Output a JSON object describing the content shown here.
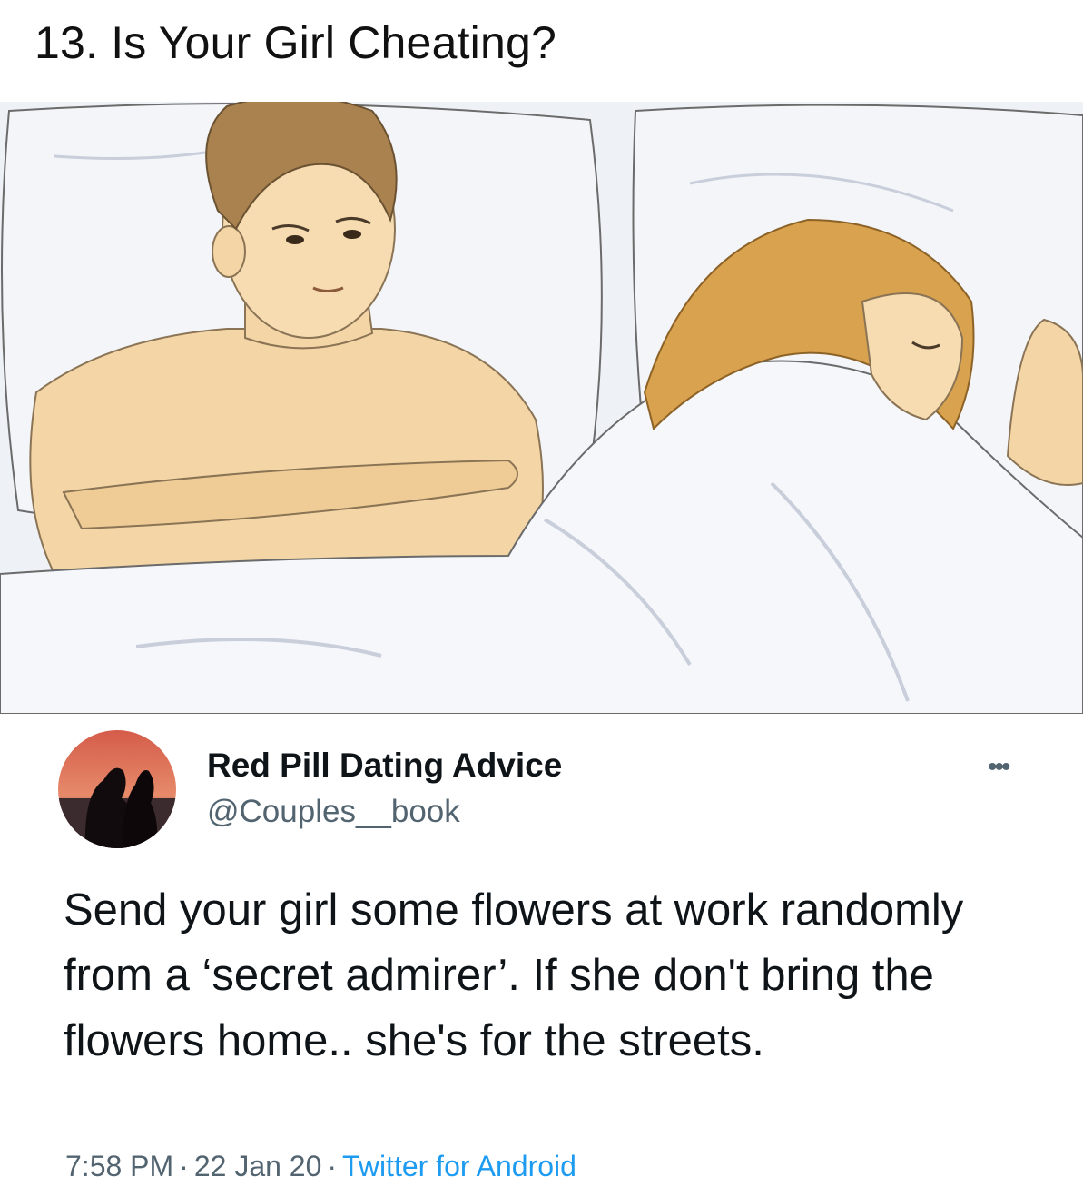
{
  "header": {
    "title": "13. Is Your Girl Cheating?"
  },
  "tweet": {
    "display_name": "Red Pill Dating Advice",
    "handle": "@Couples__book",
    "more_icon": "more-dots-icon",
    "text": "Send your girl some flowers at work randomly from a ‘secret admirer’. If she don't bring the flowers home.. she's for the streets.",
    "time": "7:58 PM",
    "separator": "·",
    "date": "22 Jan 20",
    "source": "Twitter for Android"
  },
  "colors": {
    "text_primary": "#0f1419",
    "text_secondary": "#536471",
    "link": "#1d9bf0",
    "sheet": "#eef1f6",
    "skin": "#f4d6a6",
    "hair_man": "#a9824f",
    "hair_woman": "#d9a24e"
  }
}
